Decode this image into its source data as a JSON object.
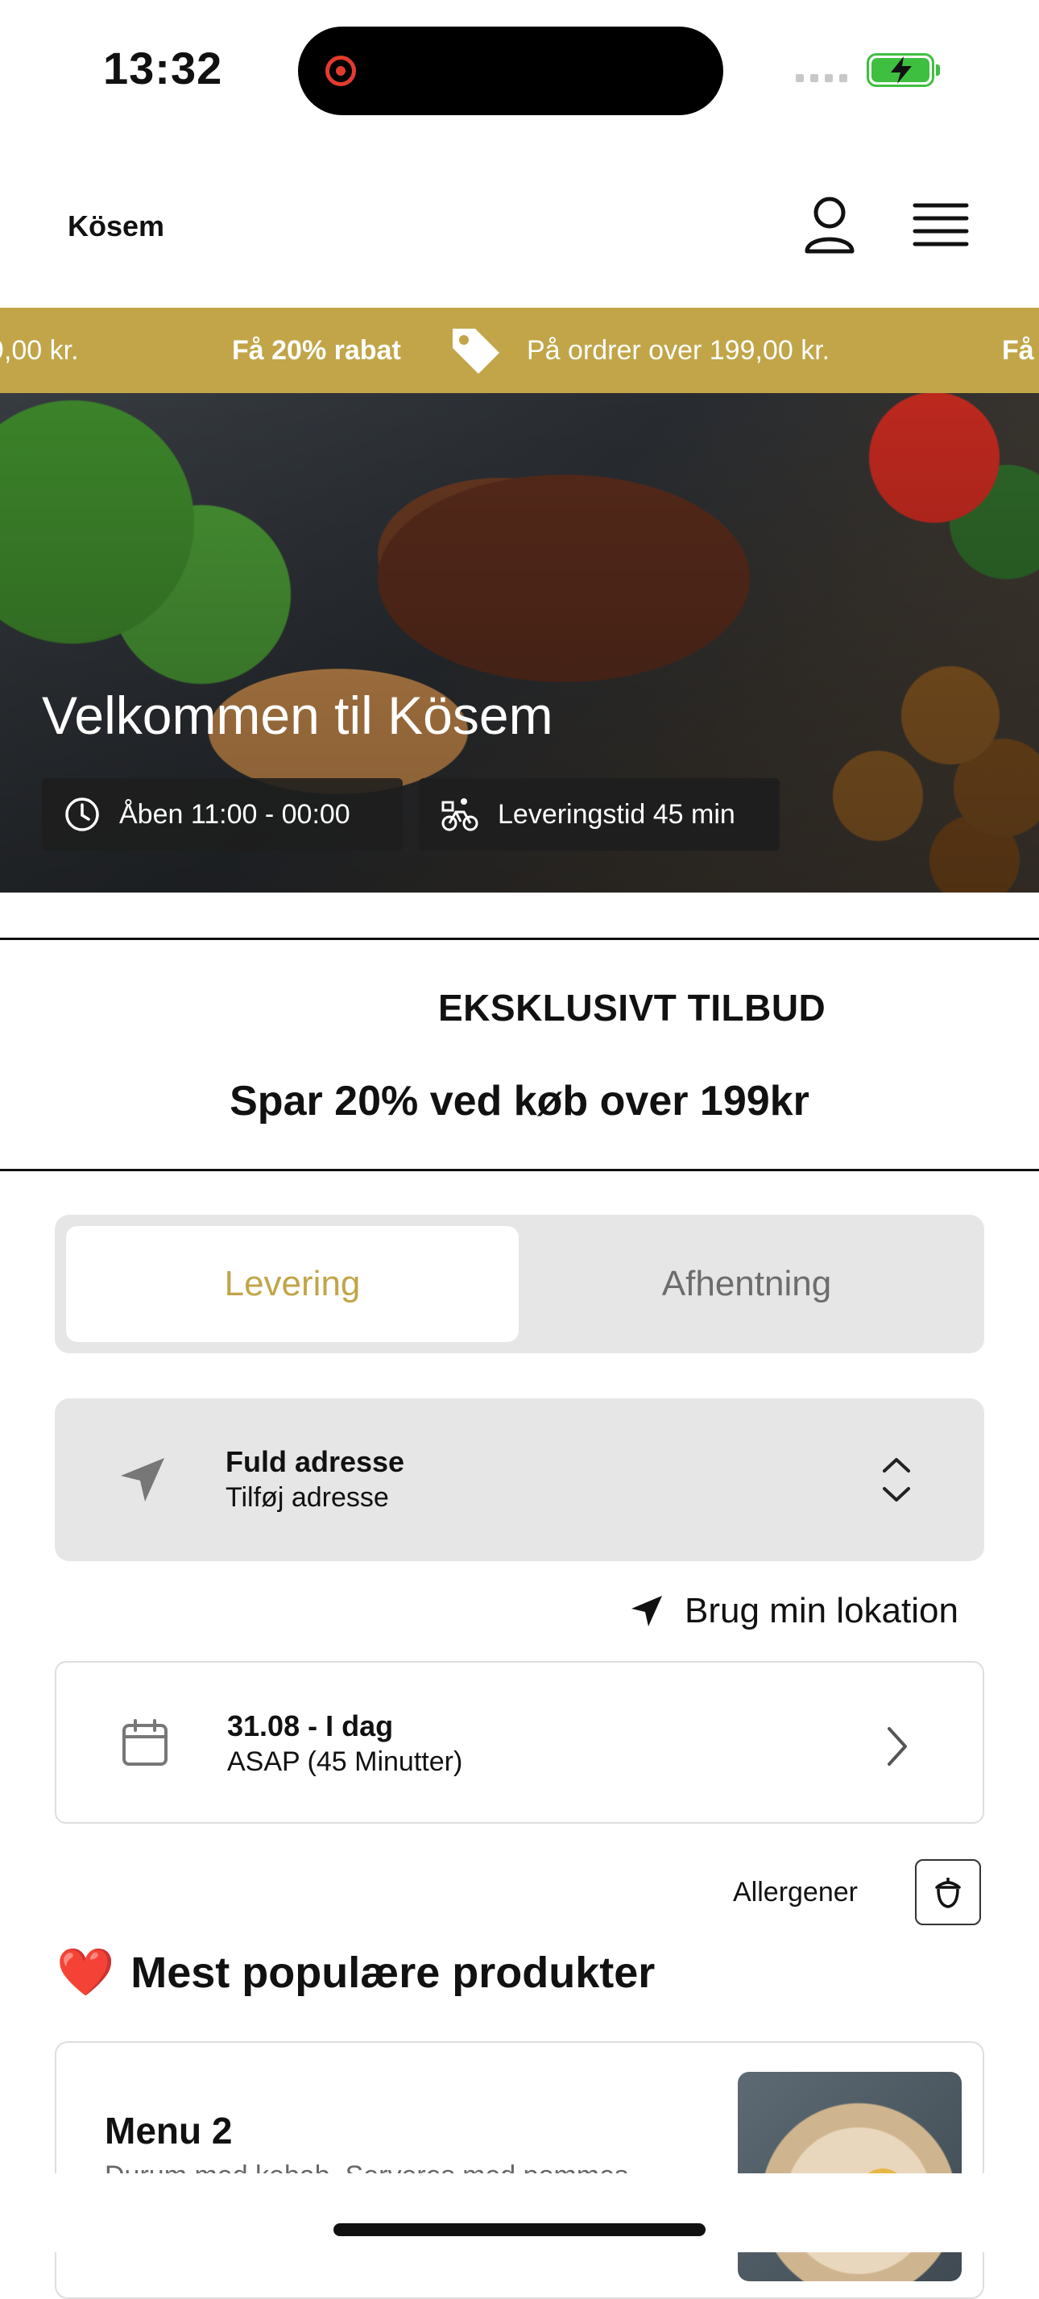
{
  "status_bar": {
    "time": "13:32"
  },
  "header": {
    "brand": "Kösem"
  },
  "ticker": {
    "left_fragment": "9,00 kr.",
    "bold_text": "Få 20% rabat",
    "text": "På ordrer over 199,00 kr.",
    "right_fragment": "Få"
  },
  "hero": {
    "title": "Velkommen til Kösem",
    "open_hours": "Åben 11:00 - 00:00",
    "delivery_time": "Leveringstid 45 min"
  },
  "offer": {
    "title": "EKSKLUSIVT TILBUD",
    "subtitle": "Spar 20% ved køb over 199kr"
  },
  "mode_tabs": {
    "delivery": "Levering",
    "pickup": "Afhentning",
    "selected": "Levering"
  },
  "address": {
    "label": "Fuld adresse",
    "value": "Tilføj adresse",
    "use_location": "Brug min lokation"
  },
  "schedule": {
    "date": "31.08 - I dag",
    "time": "ASAP (45 Minutter)"
  },
  "allergens": {
    "label": "Allergener"
  },
  "popular": {
    "emoji": "❤️",
    "heading": "Mest populære produkter",
    "items": [
      {
        "name": "Menu 2",
        "description": "Durum med kebab. Serveres med pommes"
      }
    ]
  },
  "colors": {
    "accent": "#c1a548",
    "chip_bg": "#1e1e1e",
    "panel_bg": "#e6e6e6"
  }
}
